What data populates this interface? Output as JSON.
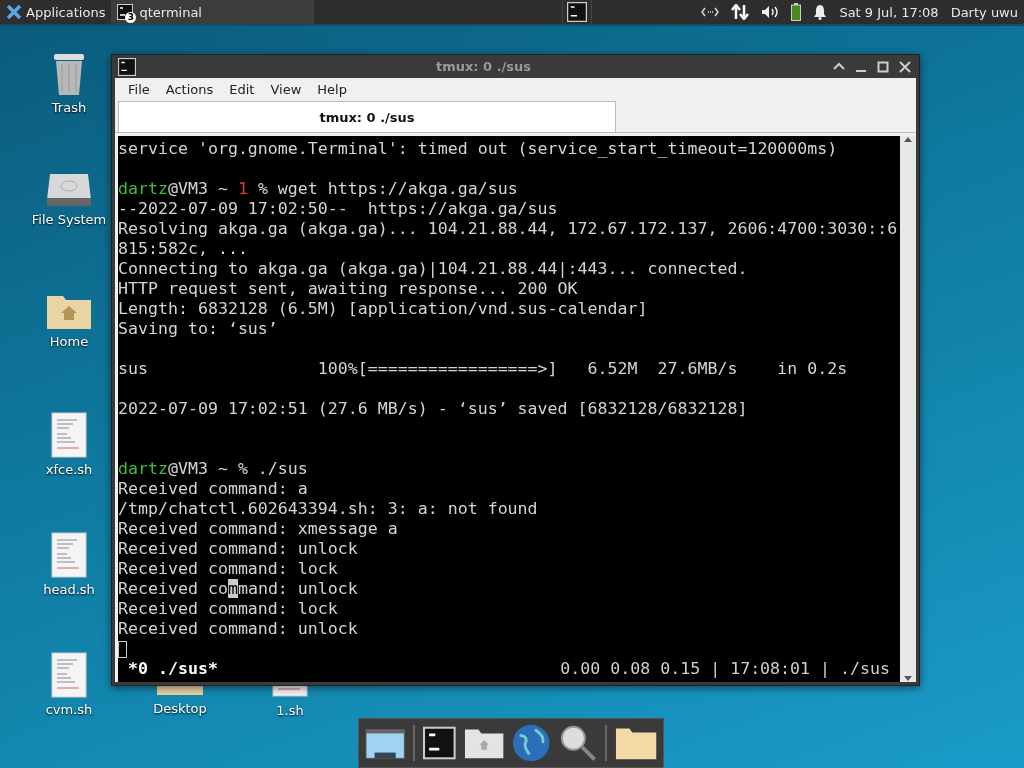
{
  "panel": {
    "menu_label": "Applications",
    "tasks": [
      {
        "label": "qterminal",
        "badge": "3",
        "selected": true
      }
    ],
    "clock": "Sat  9 Jul, 17:08",
    "user": "Darty uwu"
  },
  "desktop_icons": [
    {
      "kind": "trash",
      "label": "Trash"
    },
    {
      "kind": "drive",
      "label": "File System"
    },
    {
      "kind": "home",
      "label": "Home"
    },
    {
      "kind": "script",
      "label": "xfce.sh"
    },
    {
      "kind": "script",
      "label": "head.sh"
    },
    {
      "kind": "script",
      "label": "cvm.sh"
    }
  ],
  "hidden_icons": [
    {
      "kind": "folder",
      "label": "Desktop"
    },
    {
      "kind": "script",
      "label": "1.sh"
    }
  ],
  "window": {
    "title": "tmux: 0 ./sus",
    "menu": [
      "File",
      "Actions",
      "Edit",
      "View",
      "Help"
    ],
    "tabs": [
      {
        "label": "tmux: 0 ./sus",
        "selected": true
      }
    ],
    "lines": [
      {
        "kind": "text",
        "text": "service 'org.gnome.Terminal': timed out (service_start_timeout=120000ms)"
      },
      {
        "kind": "blank"
      },
      {
        "kind": "prompt",
        "user": "dartz",
        "host": "@VM3 ~ ",
        "code": "1",
        "command": " % wget https://akga.ga/sus"
      },
      {
        "kind": "text",
        "text": "--2022-07-09 17:02:50--  https://akga.ga/sus"
      },
      {
        "kind": "text",
        "text": "Resolving akga.ga (akga.ga)... 104.21.88.44, 172.67.172.137, 2606:4700:3030::6"
      },
      {
        "kind": "text",
        "text": "815:582c, ..."
      },
      {
        "kind": "text",
        "text": "Connecting to akga.ga (akga.ga)|104.21.88.44|:443... connected."
      },
      {
        "kind": "text",
        "text": "HTTP request sent, awaiting response... 200 OK"
      },
      {
        "kind": "text",
        "text": "Length: 6832128 (6.5M) [application/vnd.sus-calendar]"
      },
      {
        "kind": "text",
        "text": "Saving to: ‘sus’"
      },
      {
        "kind": "blank"
      },
      {
        "kind": "text",
        "text": "sus                 100%[=================>]   6.52M  27.6MB/s    in 0.2s"
      },
      {
        "kind": "blank"
      },
      {
        "kind": "text",
        "text": "2022-07-09 17:02:51 (27.6 MB/s) - ‘sus’ saved [6832128/6832128]"
      },
      {
        "kind": "blank"
      },
      {
        "kind": "blank"
      },
      {
        "kind": "prompt",
        "user": "dartz",
        "host": "@VM3 ~ ",
        "command": "% ./sus"
      },
      {
        "kind": "text",
        "text": "Received command: a"
      },
      {
        "kind": "text",
        "text": "/tmp/chatctl.602643394.sh: 3: a: not found"
      },
      {
        "kind": "text",
        "text": "Received command: xmessage a"
      },
      {
        "kind": "text",
        "text": "Received command: unlock"
      },
      {
        "kind": "text",
        "text": "Received command: lock"
      },
      {
        "kind": "cursor",
        "before": "Received co",
        "at": "m",
        "after": "mand: unlock"
      },
      {
        "kind": "text",
        "text": "Received command: lock"
      },
      {
        "kind": "text",
        "text": "Received command: unlock"
      },
      {
        "kind": "input"
      }
    ],
    "status_left": "*0 ./sus*",
    "status_right": "0.00 0.08 0.15 | 17:08:01 | ./sus"
  },
  "dock": [
    {
      "kind": "desktop"
    },
    {
      "kind": "terminal"
    },
    {
      "kind": "home"
    },
    {
      "kind": "globe"
    },
    {
      "kind": "search"
    },
    {
      "kind": "folder"
    }
  ]
}
